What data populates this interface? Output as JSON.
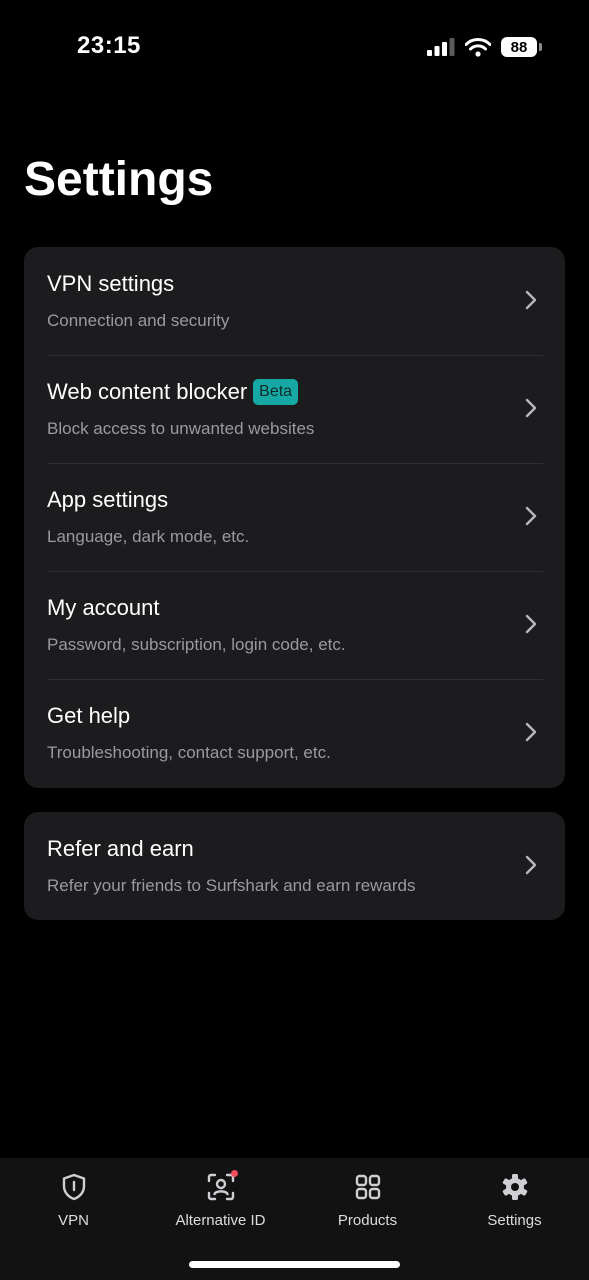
{
  "status_bar": {
    "time": "23:15",
    "battery": "88",
    "icons": [
      "signal-icon",
      "wifi-icon",
      "battery-icon"
    ]
  },
  "page": {
    "title": "Settings"
  },
  "menu": {
    "items": [
      {
        "title": "VPN settings",
        "subtitle": "Connection and security"
      },
      {
        "title": "Web content blocker",
        "badge": "Beta",
        "subtitle": "Block access to unwanted websites"
      },
      {
        "title": "App settings",
        "subtitle": "Language, dark mode, etc."
      },
      {
        "title": "My account",
        "subtitle": "Password, subscription, login code, etc."
      },
      {
        "title": "Get help",
        "subtitle": "Troubleshooting, contact support, etc."
      }
    ]
  },
  "refer": {
    "title": "Refer and earn",
    "subtitle": "Refer your friends to Surfshark and earn rewards"
  },
  "tabbar": {
    "tabs": [
      {
        "label": "VPN",
        "icon": "shield-icon"
      },
      {
        "label": "Alternative ID",
        "icon": "alternative-id-icon",
        "notification": true
      },
      {
        "label": "Products",
        "icon": "grid-icon"
      },
      {
        "label": "Settings",
        "icon": "gear-icon",
        "active": true
      }
    ]
  },
  "colors": {
    "background": "#000000",
    "card": "#1c1c1e",
    "accent_badge": "#16a9a4",
    "notification_dot": "#f24c5f",
    "subtitle_text": "#9a9a9f"
  }
}
